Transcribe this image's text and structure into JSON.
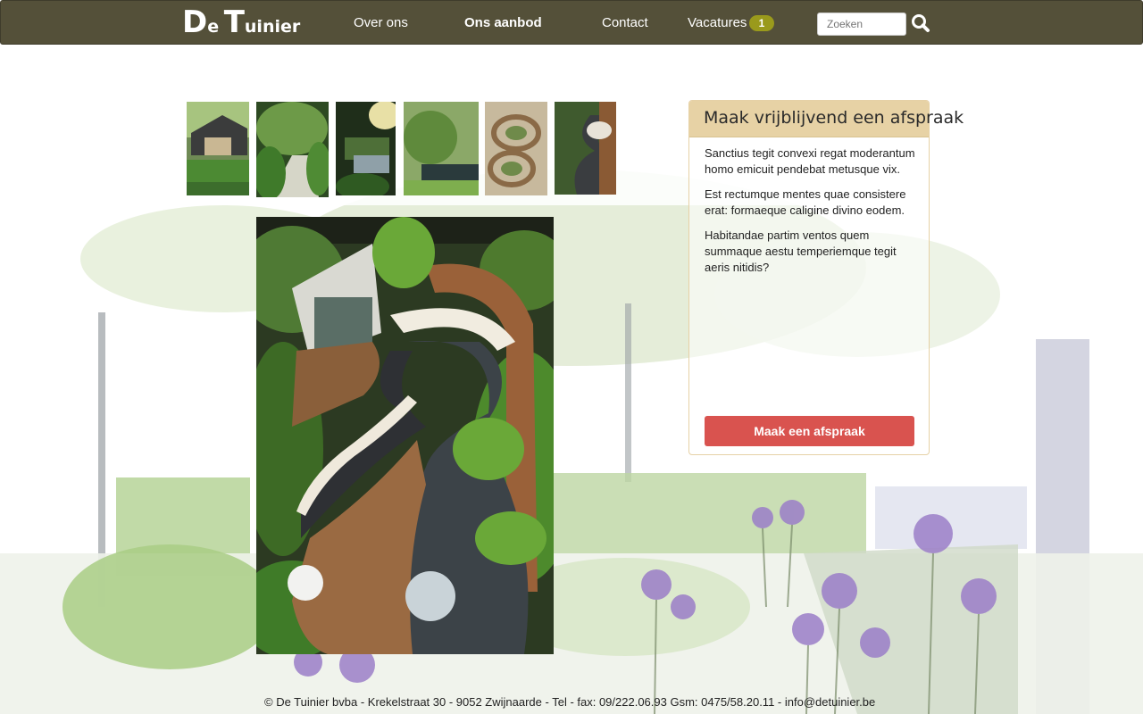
{
  "brand": {
    "logo_part1_big": "D",
    "logo_part1_small": "e",
    "logo_part2_big": "T",
    "logo_part2_small": "uinier"
  },
  "nav": {
    "items": [
      {
        "label": "Over ons",
        "active": false
      },
      {
        "label": "Ons aanbod",
        "active": true
      },
      {
        "label": "Contact",
        "active": false
      },
      {
        "label": "Vacatures",
        "active": false
      }
    ],
    "vacatures_badge": "1",
    "search_placeholder": "Zoeken",
    "search_icon": "search-icon"
  },
  "gallery": {
    "thumbnail_count": 6,
    "main_image": "selected-garden-photo"
  },
  "appointment_panel": {
    "title": "Maak vrijblijvend een afspraak",
    "paragraphs": [
      "Sanctius tegit convexi regat moderantum homo emicuit pendebat metusque vix.",
      "Est rectumque mentes quae consistere erat: formaeque caligine divino eodem.",
      "Habitandae partim ventos quem summaque aestu temperiemque tegit aeris nitidis?"
    ],
    "button_label": "Maak een afspraak"
  },
  "footer": {
    "text": "© De Tuinier bvba - Krekelstraat 30 - 9052 Zwijnaarde - Tel - fax:  09/222.06.93 Gsm:  0475/58.20.11 - info@detuinier.be"
  },
  "colors": {
    "navbar": "#545039",
    "badge": "#9a9a1c",
    "panel_header": "#e7d2a5",
    "cta": "#d9534f"
  }
}
